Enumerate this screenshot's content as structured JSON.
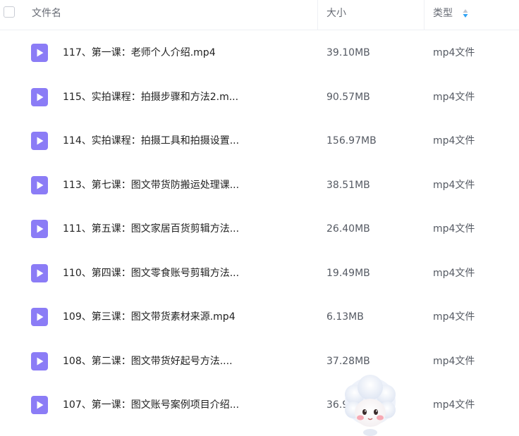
{
  "header": {
    "name_label": "文件名",
    "size_label": "大小",
    "type_label": "类型"
  },
  "files": [
    {
      "name": "117、第一课：老师个人介绍.mp4",
      "size": "39.10MB",
      "type": "mp4文件"
    },
    {
      "name": "115、实拍课程：拍摄步骤和方法2.m...",
      "size": "90.57MB",
      "type": "mp4文件"
    },
    {
      "name": "114、实拍课程：拍摄工具和拍摄设置...",
      "size": "156.97MB",
      "type": "mp4文件"
    },
    {
      "name": "113、第七课：图文带货防搬运处理课...",
      "size": "38.51MB",
      "type": "mp4文件"
    },
    {
      "name": "111、第五课：图文家居百货剪辑方法...",
      "size": "26.40MB",
      "type": "mp4文件"
    },
    {
      "name": "110、第四课：图文零食账号剪辑方法...",
      "size": "19.49MB",
      "type": "mp4文件"
    },
    {
      "name": "109、第三课：图文带货素材来源.mp4",
      "size": "6.13MB",
      "type": "mp4文件"
    },
    {
      "name": "108、第二课：图文带货好起号方法....",
      "size": "37.28MB",
      "type": "mp4文件"
    },
    {
      "name": "107、第一课：图文账号案例项目介绍...",
      "size": "36.9",
      "type": "mp4文件"
    }
  ],
  "colors": {
    "file_icon": "#8b7cf6",
    "sort_up": "#c3c6cf",
    "sort_down": "#2fa3f5"
  },
  "icons": {
    "file": "video-file-icon",
    "sort": "sort-toggle-icon",
    "mascot": "assistant-mascot-icon"
  }
}
